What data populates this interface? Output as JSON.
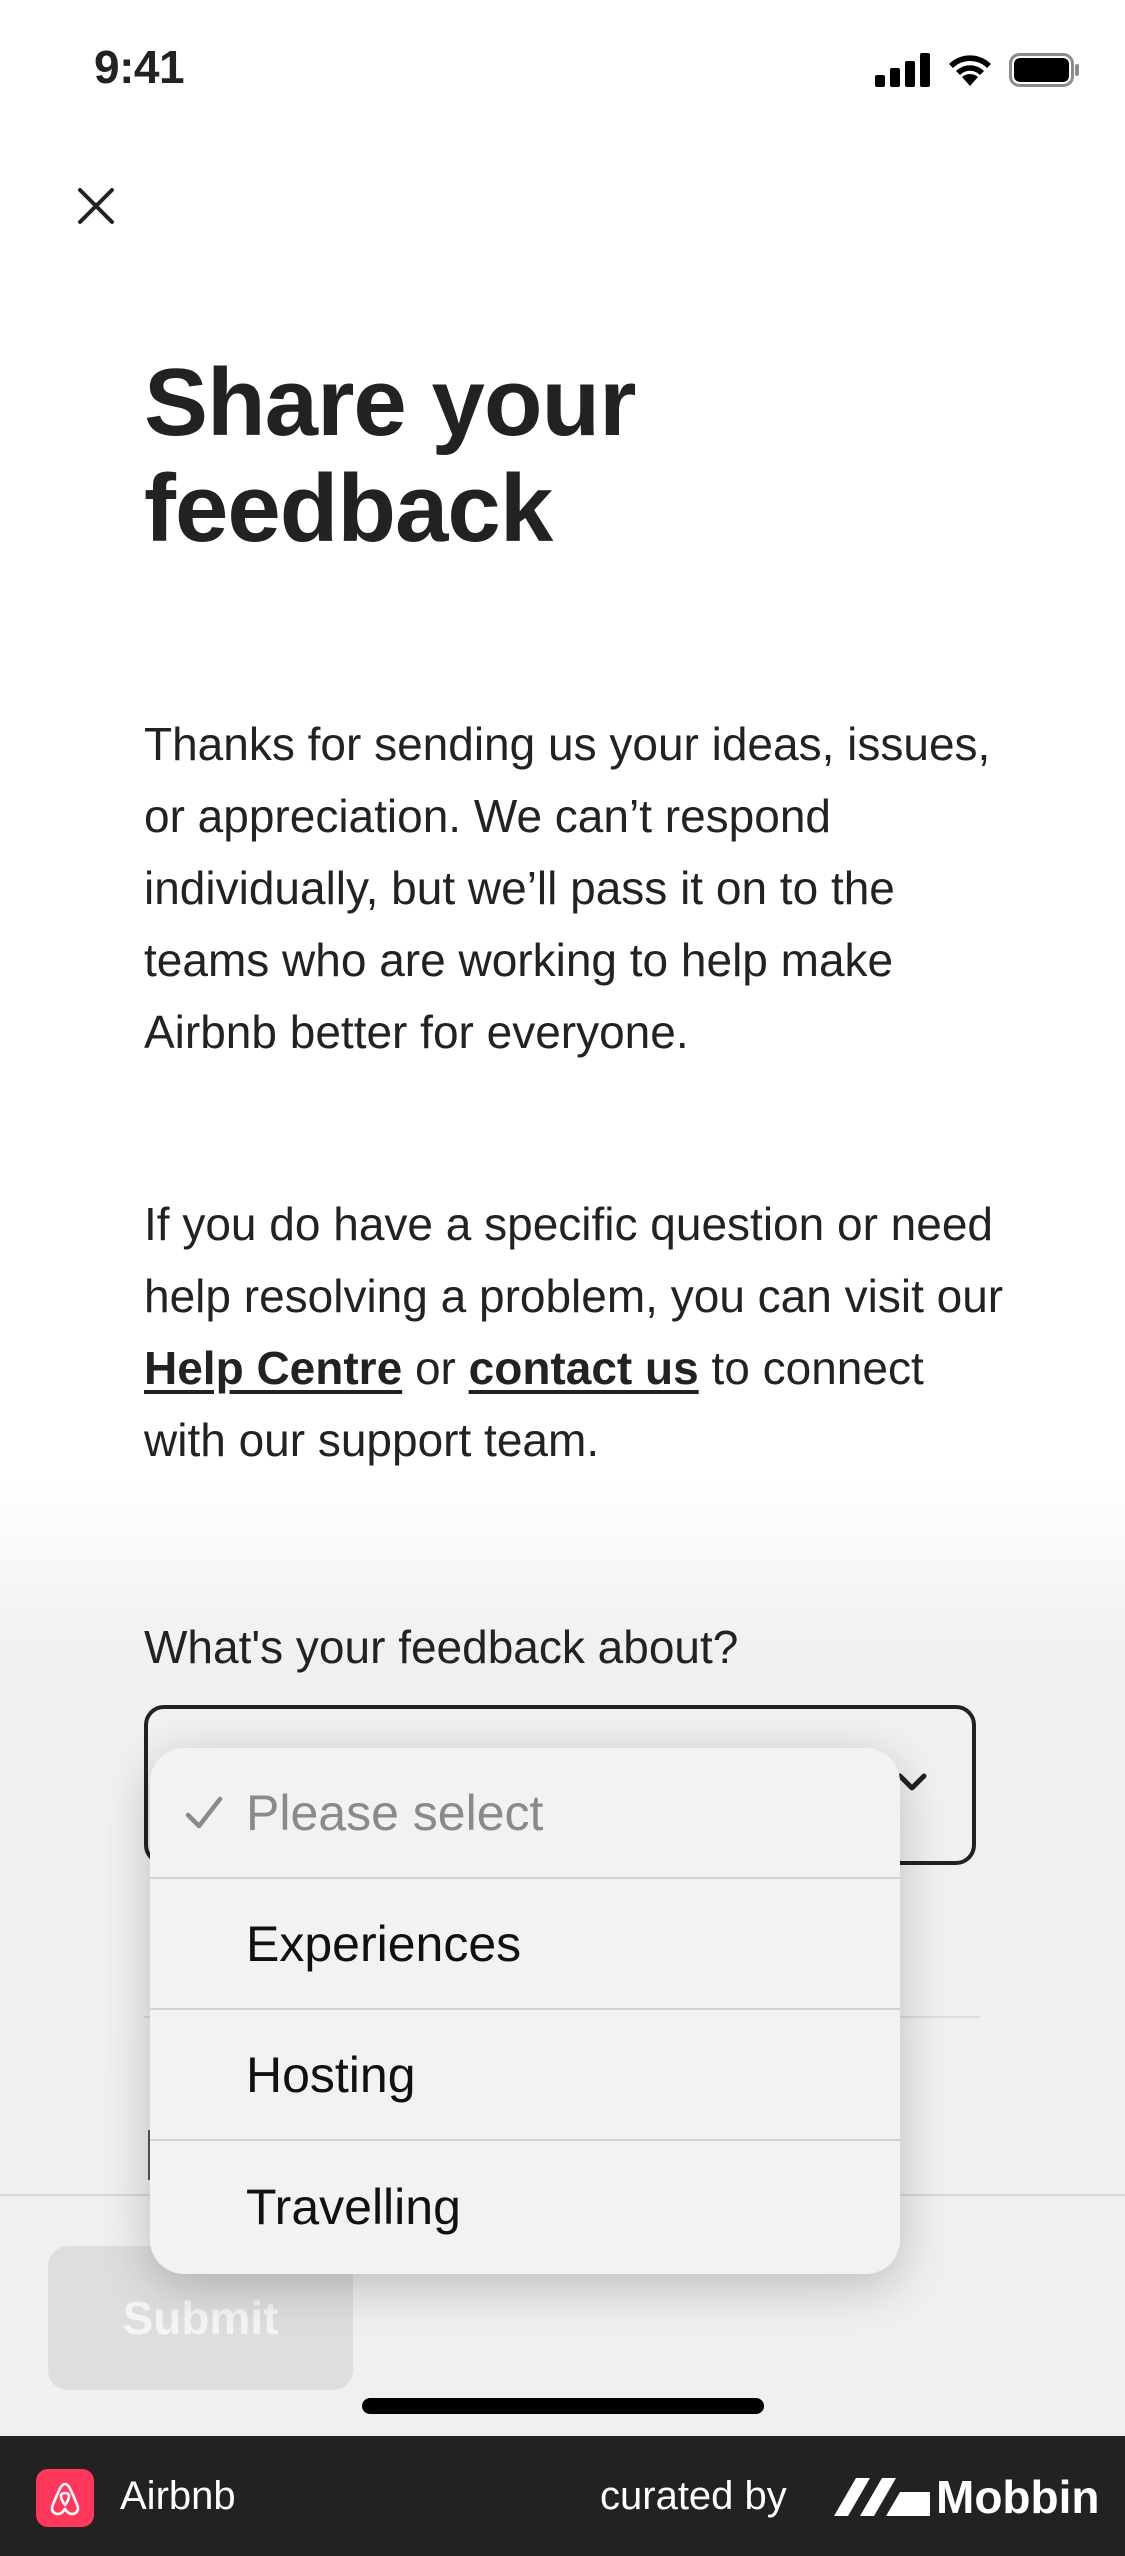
{
  "status_bar": {
    "time": "9:41"
  },
  "header": {
    "close_icon": "close-icon"
  },
  "page": {
    "title_line1": "Share your",
    "title_line2": "feedback",
    "intro": "Thanks for sending us your ideas, issues, or appreciation. We can’t respond individually, but we’ll pass it on to the teams who are working to help make Airbnb better for everyone.",
    "help_prefix": "If you do have a specific question or need help resolving a problem, you can visit our",
    "help_link": "Help Centre",
    "help_or": "or",
    "contact_link": "contact us",
    "help_suffix": "to connect with our support team."
  },
  "form": {
    "question": "What's your feedback about?",
    "submit_label": "Submit"
  },
  "dropdown": {
    "options": [
      {
        "label": "Please select",
        "selected": true
      },
      {
        "label": "Experiences"
      },
      {
        "label": "Hosting"
      },
      {
        "label": "Travelling"
      }
    ]
  },
  "footer": {
    "app_name": "Airbnb",
    "curated_by": "curated by",
    "curator": "Mobbin"
  },
  "colors": {
    "text": "#222222",
    "brand": "#ff385c",
    "footer_bg": "#222222",
    "submit_disabled_bg": "#dedede"
  }
}
